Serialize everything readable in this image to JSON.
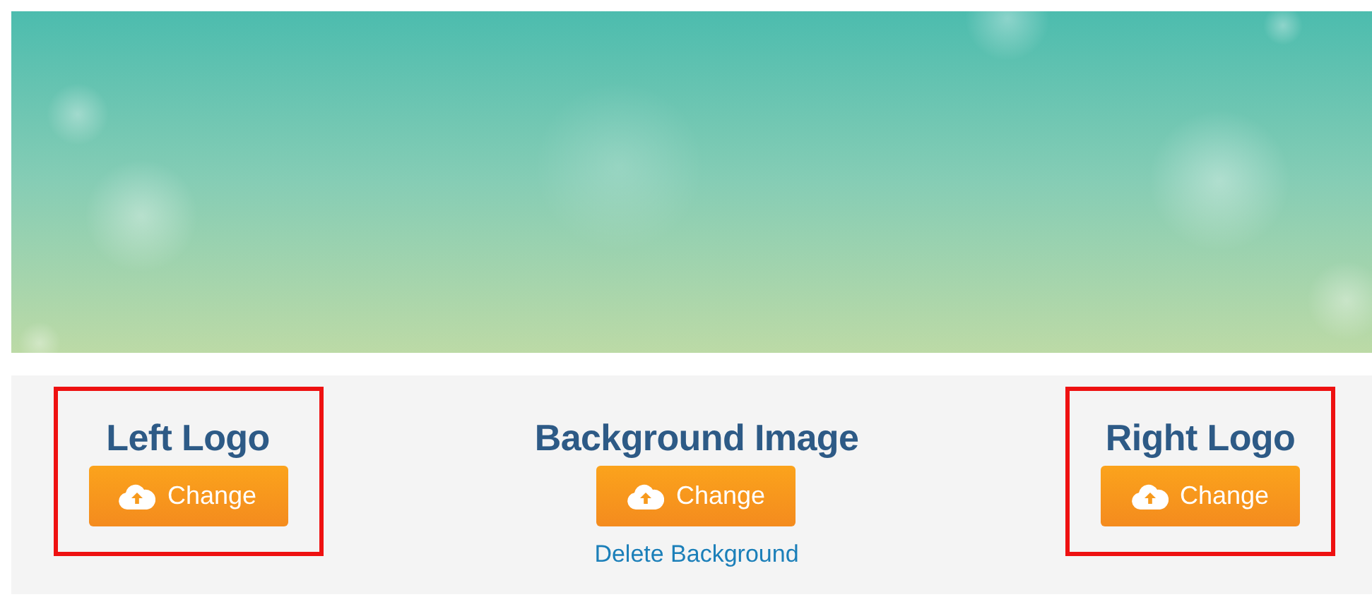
{
  "sections": [
    {
      "title": "Left Logo",
      "button": "Change",
      "highlighted": true
    },
    {
      "title": "Background Image",
      "button": "Change",
      "highlighted": false,
      "link": "Delete Background"
    },
    {
      "title": "Right Logo",
      "button": "Change",
      "highlighted": true
    }
  ]
}
